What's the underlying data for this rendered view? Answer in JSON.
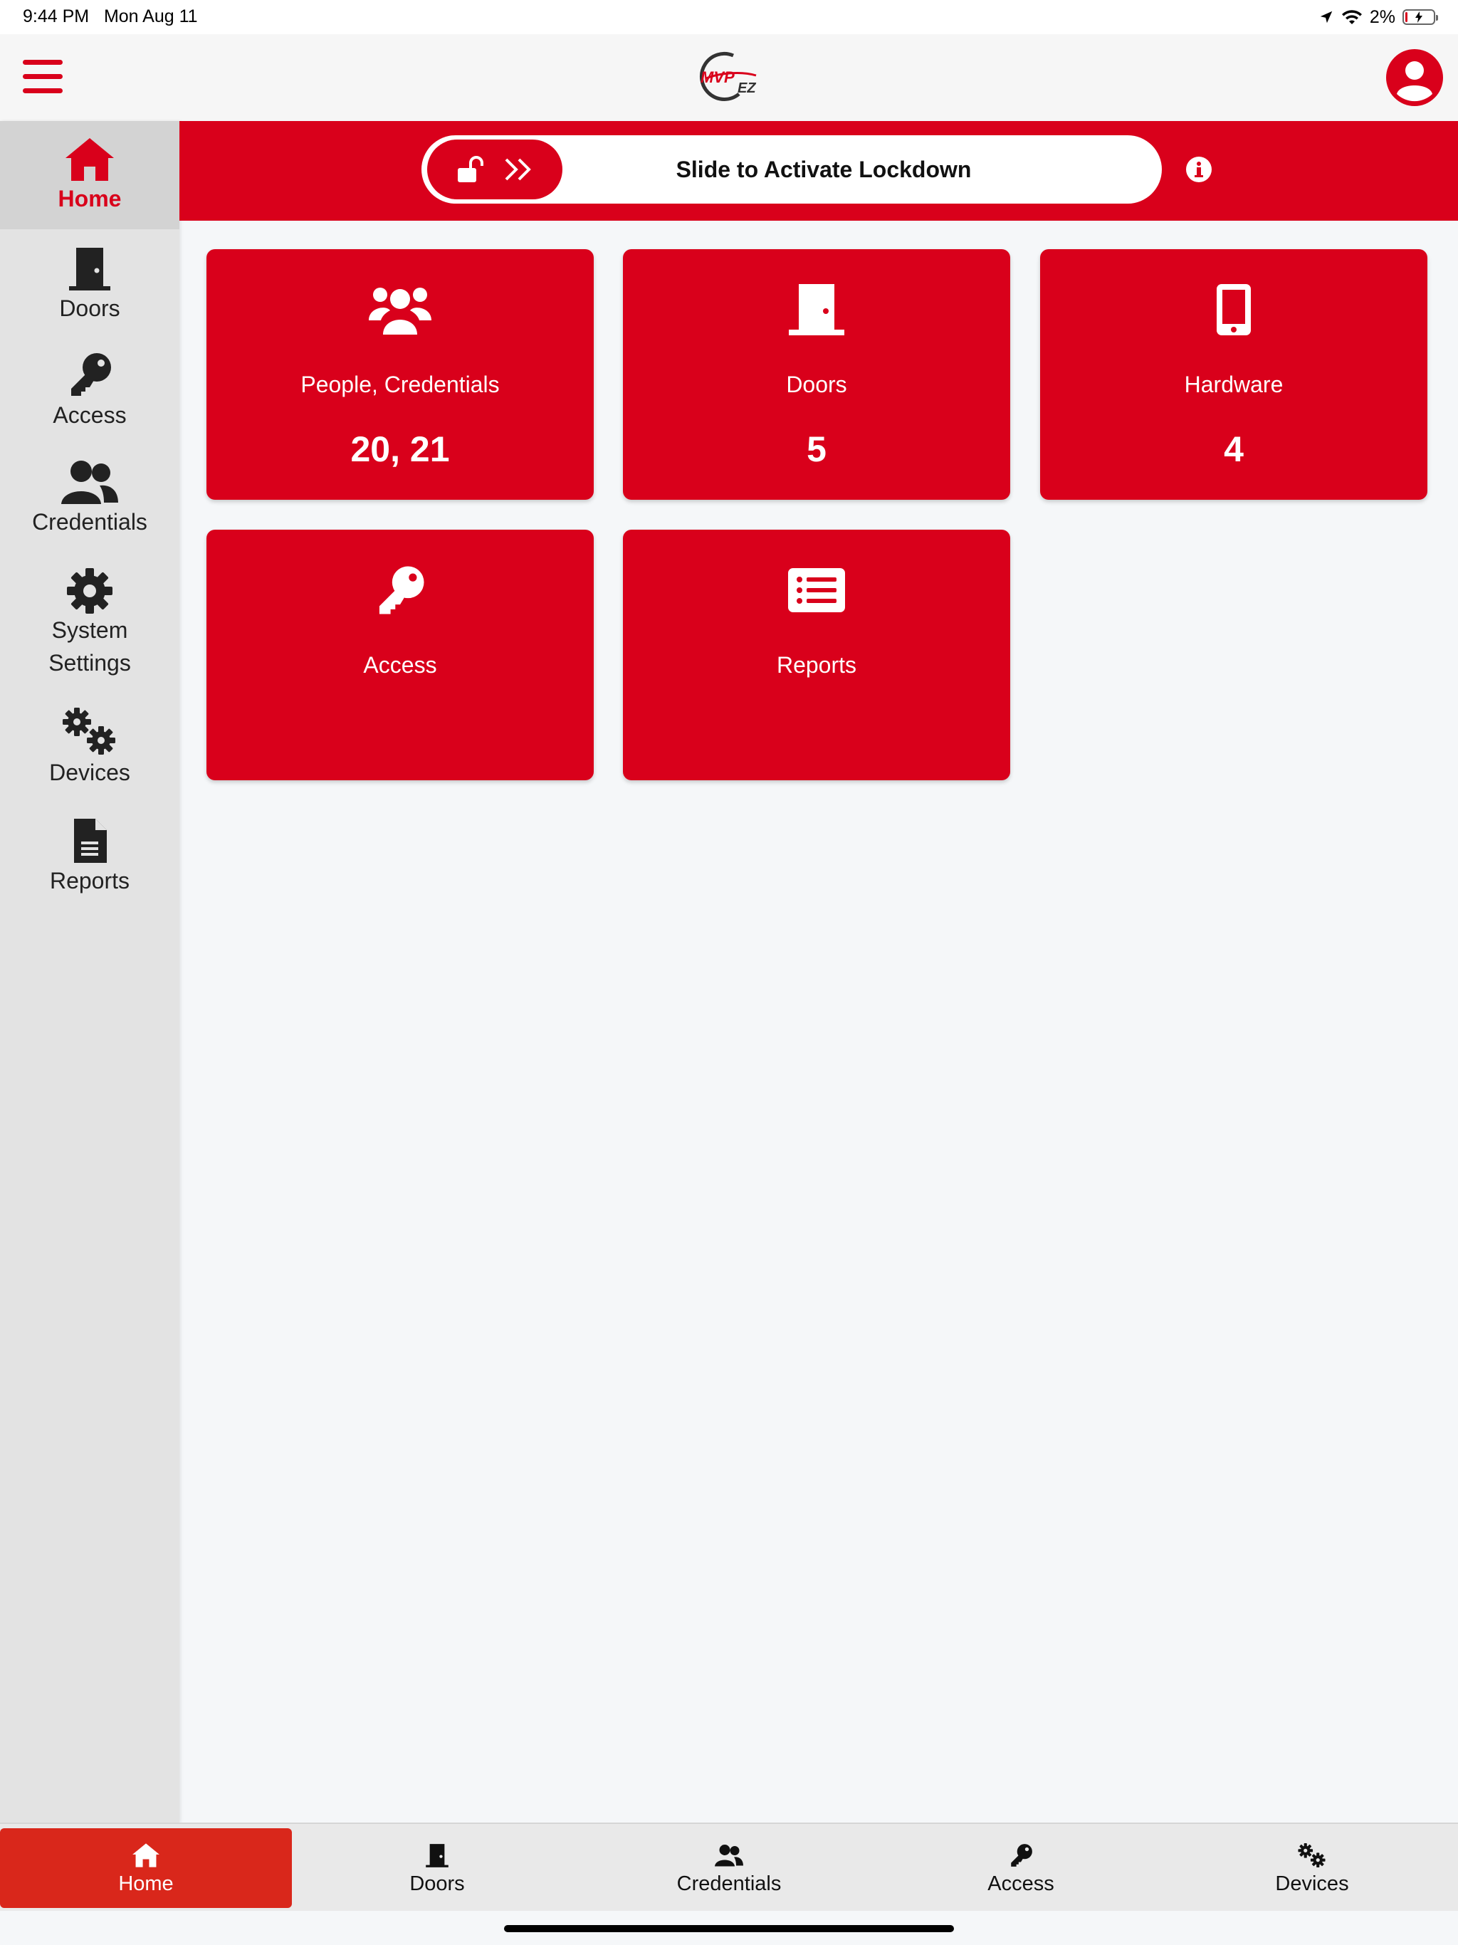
{
  "status_bar": {
    "time": "9:44 PM",
    "date": "Mon Aug 11",
    "battery": "2%"
  },
  "header": {
    "logo_text": "MVP",
    "logo_suffix": "EZ"
  },
  "sidebar": {
    "items": [
      {
        "label": "Home",
        "icon": "home-icon"
      },
      {
        "label": "Doors",
        "icon": "door-icon"
      },
      {
        "label": "Access",
        "icon": "key-icon"
      },
      {
        "label": "Credentials",
        "icon": "users-icon"
      },
      {
        "label": "System Settings",
        "line1": "System",
        "line2": "Settings",
        "icon": "gear-icon"
      },
      {
        "label": "Devices",
        "icon": "gears-icon"
      },
      {
        "label": "Reports",
        "icon": "document-icon"
      }
    ]
  },
  "lockdown": {
    "label": "Slide to Activate Lockdown"
  },
  "tiles": [
    {
      "label": "People, Credentials",
      "value": "20, 21",
      "icon": "users-icon"
    },
    {
      "label": "Doors",
      "value": "5",
      "icon": "door-icon"
    },
    {
      "label": "Hardware",
      "value": "4",
      "icon": "tablet-icon"
    },
    {
      "label": "Access",
      "value": "",
      "icon": "key-icon"
    },
    {
      "label": "Reports",
      "value": "",
      "icon": "list-icon"
    }
  ],
  "tabs": [
    {
      "label": "Home",
      "icon": "home-icon"
    },
    {
      "label": "Doors",
      "icon": "door-icon"
    },
    {
      "label": "Credentials",
      "icon": "users-icon"
    },
    {
      "label": "Access",
      "icon": "key-icon"
    },
    {
      "label": "Devices",
      "icon": "gears-icon"
    }
  ],
  "colors": {
    "brand_red": "#d9001b",
    "tab_active": "#d9271b",
    "sidebar_bg": "#e3e3e3"
  }
}
